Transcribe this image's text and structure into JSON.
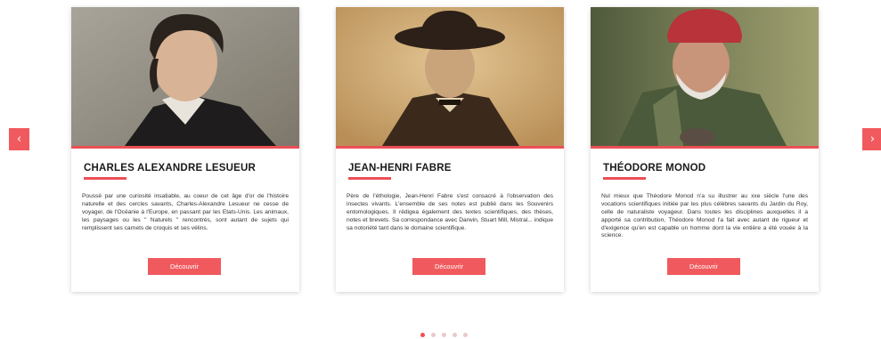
{
  "carousel": {
    "prev_icon": "chevron-left-icon",
    "next_icon": "chevron-right-icon",
    "accent_color": "#f05a5e",
    "page_count": 5,
    "active_page": 1
  },
  "cards": [
    {
      "name": "CHARLES ALEXANDRE LESUEUR",
      "description": "Poussé par une curiosité insatiable, au coeur de cet âge d'or de l'histoire naturelle et des cercles savants, Charles-Alexandre Lesueur ne cesse de voyager, de l'Océanie à l'Europe, en passant par les Etats-Unis. Les animaux, les paysages ou les \" Naturels \" rencontrés, sont autant de sujets qui remplissent ses carnets de croquis et ses vélins.",
      "button_label": "Découvrir"
    },
    {
      "name": "JEAN-HENRI FABRE",
      "description": "Père de l'éthologie, Jean-Henri Fabre s'est consacré à l'observation des insectes vivants. L'ensemble de ses notes est publié dans les Souvenirs entomologiques. Il rédigea également des textes scientifiques, des thèses, notes et brevets. Sa correspondance avec Darwin, Stuart Mill, Mistral... indique sa notoriété tant dans le domaine scientifique.",
      "button_label": "Découvrir"
    },
    {
      "name": "THÉODORE MONOD",
      "description": "Nul mieux que Théodore Monod n'a su illustrer au xxe siècle l'une des vocations scientifiques initiée par les plus célèbres savants du Jardin du Roy, celle de naturaliste voyageur. Dans toutes les disciplines auxquelles il a apporté sa contribution, Théodore Monod l'a fait avec autant de rigueur et d'exigence qu'en est capable un homme dont la vie entière a été vouée à la science.",
      "button_label": "Découvrir"
    }
  ]
}
